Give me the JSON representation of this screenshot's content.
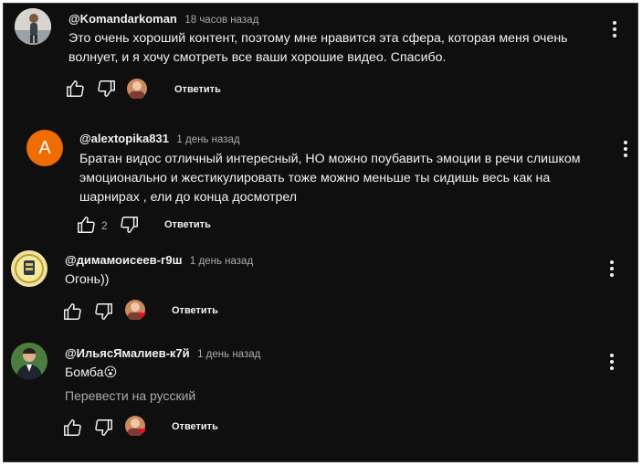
{
  "comments": [
    {
      "author": "@Komandarkoman",
      "time": "18 часов назад",
      "lines": [
        "Это очень хороший контент, поэтому мне нравится эта сфера, которая меня очень",
        "волнует, и я хочу смотреть все ваши хорошие видео. Спасибо."
      ],
      "likes": "",
      "reply_label": "Ответить"
    },
    {
      "author": "@alextopika831",
      "time": "1 день назад",
      "avatar_letter": "A",
      "lines": [
        "Братан видос отличный интересный, НО можно поубавить эмоции в речи слишком",
        "эмоционально и жестикулировать тоже можно меньше ты сидишь весь как на",
        "шарнирах , ели до конца досмотрел"
      ],
      "likes": "2",
      "reply_label": "Ответить"
    },
    {
      "author": "@димамоисеев-г9ш",
      "time": "1 день назад",
      "lines": [
        "Огонь))"
      ],
      "likes": "",
      "reply_label": "Ответить"
    },
    {
      "author": "@ИльясЯмалиев-к7й",
      "time": "1 день назад",
      "lines": [
        "Бомба😮"
      ],
      "translate": "Перевести на русский",
      "likes": "",
      "reply_label": "Ответить"
    }
  ],
  "colors": {
    "background": "#0f0f0f",
    "text": "#f1f1f1",
    "secondary": "#aaaaaa",
    "avatar_orange": "#ef6c00"
  }
}
